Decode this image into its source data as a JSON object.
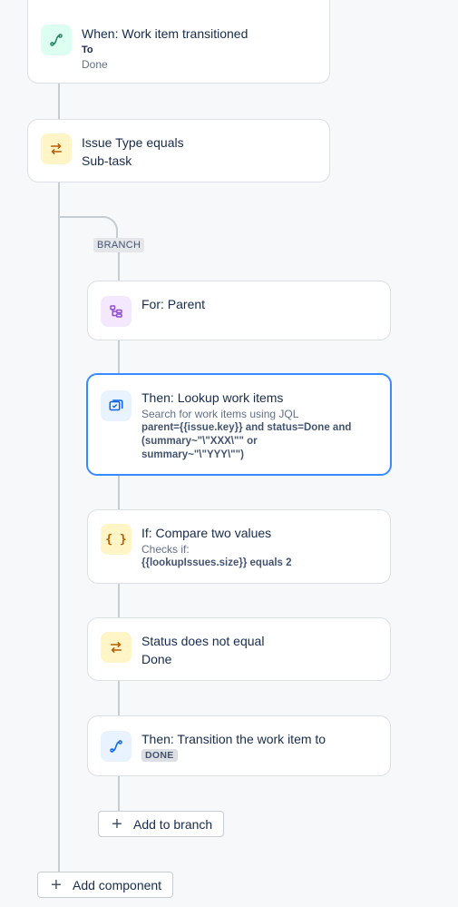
{
  "trigger": {
    "title": "When: Work item transitioned",
    "label": "To",
    "value": "Done"
  },
  "condition1": {
    "title": "Issue Type equals",
    "value": "Sub-task"
  },
  "branch": {
    "badge": "BRANCH",
    "for": {
      "title": "For: Parent"
    },
    "lookup": {
      "title": "Then: Lookup work items",
      "sub": "Search for work items using JQL",
      "jql_line1": "parent={{issue.key}} and status=Done and",
      "jql_line2": "(summary~\"\\\"XXX\\\"\" or",
      "jql_line3": "summary~\"\\\"YYY\\\"\")"
    },
    "if": {
      "title": "If: Compare two values",
      "sub": "Checks if:",
      "expr": "{{lookupIssues.size}} equals 2"
    },
    "status": {
      "title": "Status does not equal",
      "value": "Done"
    },
    "transition": {
      "title": "Then: Transition the work item to",
      "status": "DONE"
    },
    "add_label": "Add to branch"
  },
  "add_component_label": "Add component"
}
